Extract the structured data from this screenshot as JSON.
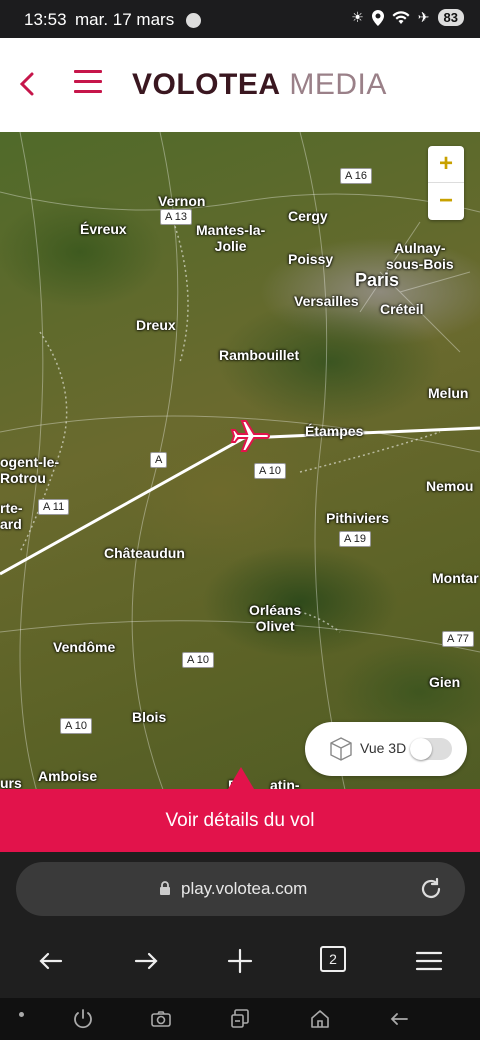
{
  "status_bar": {
    "time": "13:53",
    "date": "mar. 17 mars",
    "battery": "83"
  },
  "app_bar": {
    "logo_brand": "VOLOTEA",
    "logo_suffix": "MEDIA"
  },
  "map": {
    "places": [
      {
        "id": "vernon",
        "label": "Vernon"
      },
      {
        "id": "evreux",
        "label": "Évreux"
      },
      {
        "id": "mantes",
        "label": "Mantes-la-\nJolie"
      },
      {
        "id": "cergy",
        "label": "Cergy"
      },
      {
        "id": "aulnay",
        "label": "Aulnay-\nsous-Bois"
      },
      {
        "id": "poissy",
        "label": "Poissy"
      },
      {
        "id": "paris",
        "label": "Paris"
      },
      {
        "id": "versailles",
        "label": "Versailles"
      },
      {
        "id": "creteil",
        "label": "Créteil"
      },
      {
        "id": "dreux",
        "label": "Dreux"
      },
      {
        "id": "rambouillet",
        "label": "Rambouillet"
      },
      {
        "id": "melun",
        "label": "Melun"
      },
      {
        "id": "etampes",
        "label": "Étampes"
      },
      {
        "id": "nogent",
        "label": "ogent-le-\nRotrou"
      },
      {
        "id": "nemours",
        "label": "Nemou"
      },
      {
        "id": "ferte",
        "label": "rte-\nard"
      },
      {
        "id": "pithiviers",
        "label": "Pithiviers"
      },
      {
        "id": "chateaudun",
        "label": "Châteaudun"
      },
      {
        "id": "montargis",
        "label": "Montar"
      },
      {
        "id": "orleans",
        "label": "Orléans\nOlivet"
      },
      {
        "id": "vendome",
        "label": "Vendôme"
      },
      {
        "id": "gien",
        "label": "Gien"
      },
      {
        "id": "blois",
        "label": "Blois"
      },
      {
        "id": "amboise",
        "label": "Amboise"
      },
      {
        "id": "tours",
        "label": "urs"
      },
      {
        "id": "romorantin",
        "label": "Ro      atin-"
      }
    ],
    "roads": [
      {
        "id": "a16",
        "label": "A 16"
      },
      {
        "id": "a13",
        "label": "A 13"
      },
      {
        "id": "a10a",
        "label": "A"
      },
      {
        "id": "a10b",
        "label": "A 10"
      },
      {
        "id": "a11",
        "label": "A 11"
      },
      {
        "id": "a19",
        "label": "A 19"
      },
      {
        "id": "a77",
        "label": "A 77"
      },
      {
        "id": "a10c",
        "label": "A 10"
      },
      {
        "id": "a10d",
        "label": "A 10"
      }
    ],
    "zoom_in": "+",
    "zoom_out": "−",
    "vue3d_label": "Vue 3D",
    "vue3d_on": false
  },
  "cta_label": "Voir détails du vol",
  "browser": {
    "url": "play.volotea.com",
    "tab_count": "2"
  }
}
